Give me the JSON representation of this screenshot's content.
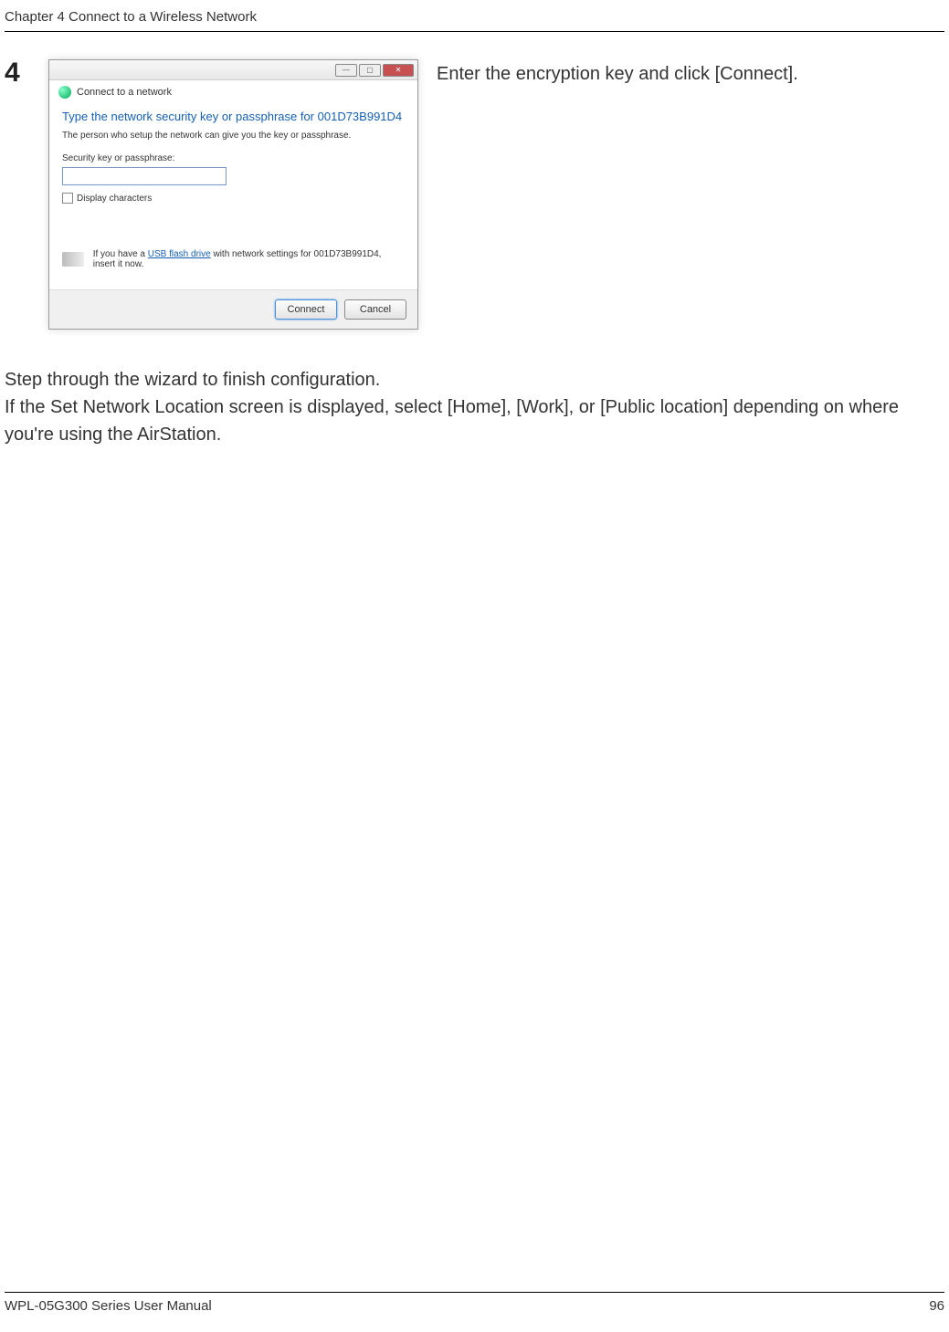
{
  "header": {
    "chapter": "Chapter 4  Connect to a Wireless Network"
  },
  "step": {
    "number": "4",
    "caption": "Enter the encryption key and click [Connect]."
  },
  "dialog": {
    "sub_title": "Connect to a network",
    "heading": "Type the network security key or passphrase for 001D73B991D4",
    "description": "The person who setup the network can give you the key or passphrase.",
    "input_label": "Security key or passphrase:",
    "input_value": "",
    "checkbox_label": "Display characters",
    "usb_prefix": "If you have a ",
    "usb_link": "USB flash drive",
    "usb_suffix": " with network settings for 001D73B991D4, insert it now.",
    "connect_label": "Connect",
    "cancel_label": "Cancel",
    "win_min": "—",
    "win_max": "▢",
    "win_close": "✕"
  },
  "after": {
    "line1": "Step through the wizard to finish configuration.",
    "line2": "If the Set Network Location screen is displayed, select [Home], [Work], or [Public location] depending on where you're using the AirStation."
  },
  "footer": {
    "manual": "WPL-05G300 Series User Manual",
    "page": "96"
  }
}
